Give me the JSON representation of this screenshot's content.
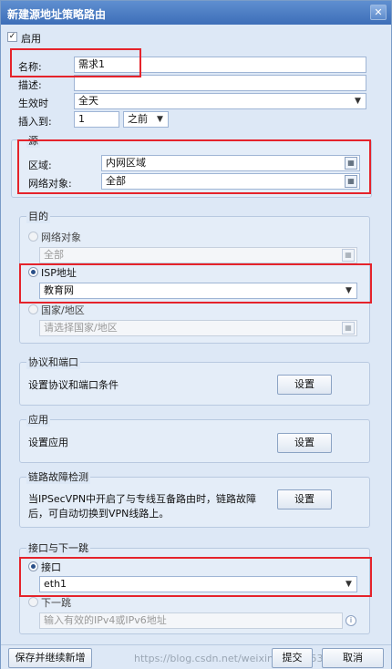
{
  "window": {
    "title": "新建源地址策略路由"
  },
  "enable": {
    "label": "启用",
    "checked": true
  },
  "form": {
    "name_label": "名称:",
    "name_value": "需求1",
    "desc_label": "描述:",
    "desc_value": "",
    "effective_label": "生效时",
    "effective_value": "全天",
    "insert_label": "插入到:",
    "insert_value": "1",
    "insert_pos": "之前"
  },
  "source": {
    "title": "源",
    "zone_label": "区域:",
    "zone_value": "内网区域",
    "netobj_label": "网络对象:",
    "netobj_value": "全部"
  },
  "destination": {
    "title": "目的",
    "netobj_label": "网络对象",
    "netobj_value": "全部",
    "isp_label": "ISP地址",
    "isp_value": "教育网",
    "country_label": "国家/地区",
    "country_placeholder": "请选择国家/地区"
  },
  "protocol": {
    "title": "协议和端口",
    "desc": "设置协议和端口条件",
    "button": "设置"
  },
  "app": {
    "title": "应用",
    "desc": "设置应用",
    "button": "设置"
  },
  "link": {
    "title": "链路故障检测",
    "desc_line1": "当IPSecVPN中开启了与专线互备路由时，链路故障",
    "desc_line2": "后，可自动切换到VPN线路上。",
    "button": "设置"
  },
  "nexthop": {
    "title": "接口与下一跳",
    "iface_label": "接口",
    "iface_value": "eth1",
    "next_label": "下一跳",
    "next_placeholder": "输入有效的IPv4或IPv6地址"
  },
  "footer": {
    "save_new": "保存并继续新增",
    "submit": "提交",
    "cancel": "取消",
    "watermark": "https://blog.csdn.net/weixin_43907530"
  },
  "accent": {
    "highlight": "#e5232b",
    "title": "#3d6eb8"
  }
}
